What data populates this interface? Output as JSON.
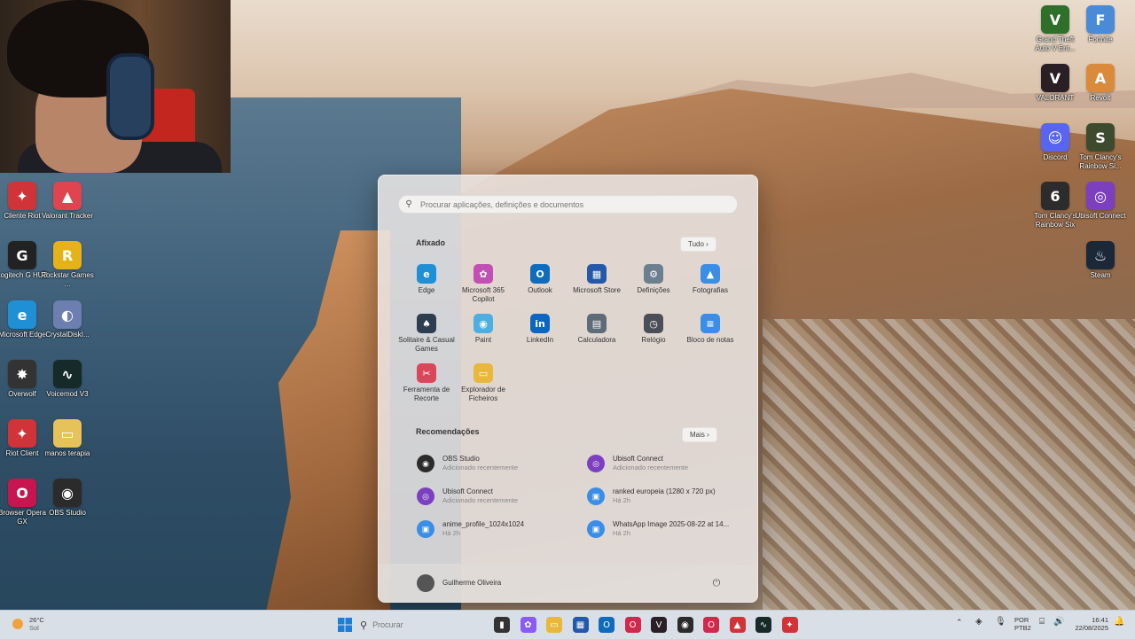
{
  "desktop": {
    "left_icons": [
      {
        "label": "Cliente Riot",
        "color": "#d13438",
        "glyph": "✦"
      },
      {
        "label": "Valorant Tracker",
        "color": "#e0444f",
        "glyph": "▲"
      },
      {
        "label": "Logitech G HUB",
        "color": "#222222",
        "glyph": "G"
      },
      {
        "label": "Rockstar Games ...",
        "color": "#e5b318",
        "glyph": "R"
      },
      {
        "label": "Microsoft Edge",
        "color": "#1f8fd6",
        "glyph": "e"
      },
      {
        "label": "CrystalDiskI...",
        "color": "#6c7fb0",
        "glyph": "◐"
      },
      {
        "label": "Overwolf",
        "color": "#333333",
        "glyph": "✸"
      },
      {
        "label": "Voicemod V3",
        "color": "#162a2a",
        "glyph": "∿"
      },
      {
        "label": "Riot Client",
        "color": "#d13438",
        "glyph": "✦"
      },
      {
        "label": "manos terapia",
        "color": "#e5c35a",
        "glyph": "▭"
      },
      {
        "label": "Browser Opera GX",
        "color": "#c8154f",
        "glyph": "O"
      },
      {
        "label": "OBS Studio",
        "color": "#2b2b2b",
        "glyph": "◉"
      }
    ],
    "right_icons": [
      {
        "label": "Grand Theft Auto V Ent...",
        "color": "#2e6f2a",
        "glyph": "V"
      },
      {
        "label": "Fortnite",
        "color": "#4a8bd8",
        "glyph": "F"
      },
      {
        "label": "VALORANT",
        "color": "#2a1f24",
        "glyph": "V"
      },
      {
        "label": "Revolt",
        "color": "#d98a3a",
        "glyph": "A"
      },
      {
        "label": "Discord",
        "color": "#5865f2",
        "glyph": "☺"
      },
      {
        "label": "Tom Clancy's Rainbow Si...",
        "color": "#3e4a2e",
        "glyph": "S"
      },
      {
        "label": "Tom Clancy's Rainbow Six",
        "color": "#2c2c2c",
        "glyph": "6"
      },
      {
        "label": "Ubisoft Connect",
        "color": "#7b3fbf",
        "glyph": "◎"
      },
      {
        "label": "Steam",
        "color": "#1b2838",
        "glyph": "♨"
      }
    ]
  },
  "start_menu": {
    "search_placeholder": "Procurar aplicações, definições e documentos",
    "pinned_title": "Afixado",
    "pinned_more": "Tudo  ›",
    "pinned": [
      {
        "label": "Edge",
        "color": "#1f8fd6",
        "glyph": "e"
      },
      {
        "label": "Microsoft 365 Copilot",
        "color": "#c24fb3",
        "glyph": "✿"
      },
      {
        "label": "Outlook",
        "color": "#0f6cbd",
        "glyph": "O"
      },
      {
        "label": "Microsoft Store",
        "color": "#2458a8",
        "glyph": "▦"
      },
      {
        "label": "Definições",
        "color": "#6b7f8e",
        "glyph": "⚙"
      },
      {
        "label": "Fotografias",
        "color": "#3a8ee6",
        "glyph": "▲"
      },
      {
        "label": "Solitaire & Casual Games",
        "color": "#2c3e50",
        "glyph": "♠"
      },
      {
        "label": "Paint",
        "color": "#4bb0e0",
        "glyph": "◉"
      },
      {
        "label": "LinkedIn",
        "color": "#0a66c2",
        "glyph": "in"
      },
      {
        "label": "Calculadora",
        "color": "#5f6b78",
        "glyph": "▤"
      },
      {
        "label": "Relógio",
        "color": "#4a4f57",
        "glyph": "◷"
      },
      {
        "label": "Bloco de notas",
        "color": "#3a8ee6",
        "glyph": "≡"
      },
      {
        "label": "Ferramenta de Recorte",
        "color": "#d9475a",
        "glyph": "✂"
      },
      {
        "label": "Explorador de Ficheiros",
        "color": "#e8b73c",
        "glyph": "▭"
      }
    ],
    "rec_title": "Recomendações",
    "rec_more": "Mais  ›",
    "recommended": [
      {
        "title": "OBS Studio",
        "sub": "Adicionado recentemente",
        "color": "#2b2b2b",
        "glyph": "◉"
      },
      {
        "title": "Ubisoft Connect",
        "sub": "Adicionado recentemente",
        "color": "#7b3fbf",
        "glyph": "◎"
      },
      {
        "title": "Ubisoft Connect",
        "sub": "Adicionado recentemente",
        "color": "#7b3fbf",
        "glyph": "◎"
      },
      {
        "title": "ranked europeia (1280 x 720 px)",
        "sub": "Há 2h",
        "color": "#3a8ee6",
        "glyph": "▣"
      },
      {
        "title": "anime_profile_1024x1024",
        "sub": "Há 2h",
        "color": "#3a8ee6",
        "glyph": "▣"
      },
      {
        "title": "WhatsApp Image 2025-08-22 at 14...",
        "sub": "Há 2h",
        "color": "#3a8ee6",
        "glyph": "▣"
      }
    ],
    "user_name": "Guilherme Oliveira"
  },
  "taskbar": {
    "weather_temp": "26°C",
    "weather_desc": "Sol",
    "search_label": "Procurar",
    "apps": [
      {
        "name": "file-explorer",
        "color": "#333333",
        "glyph": "▮"
      },
      {
        "name": "copilot",
        "color": "#8a5cf6",
        "glyph": "✿"
      },
      {
        "name": "folder",
        "color": "#e8b73c",
        "glyph": "▭"
      },
      {
        "name": "store",
        "color": "#2458a8",
        "glyph": "▦"
      },
      {
        "name": "outlook",
        "color": "#0f6cbd",
        "glyph": "O"
      },
      {
        "name": "opera",
        "color": "#d0294b",
        "glyph": "O"
      },
      {
        "name": "valorant",
        "color": "#2a1f24",
        "glyph": "V"
      },
      {
        "name": "obs",
        "color": "#2b2b2b",
        "glyph": "◉"
      },
      {
        "name": "opera-gx",
        "color": "#d0294b",
        "glyph": "O"
      },
      {
        "name": "valorant-tracker",
        "color": "#d13438",
        "glyph": "▲"
      },
      {
        "name": "voicemod",
        "color": "#162a2a",
        "glyph": "∿"
      },
      {
        "name": "riot",
        "color": "#d13438",
        "glyph": "✦"
      }
    ],
    "lang_top": "POR",
    "lang_bottom": "PTB2",
    "time": "16:41",
    "date": "22/08/2025"
  }
}
